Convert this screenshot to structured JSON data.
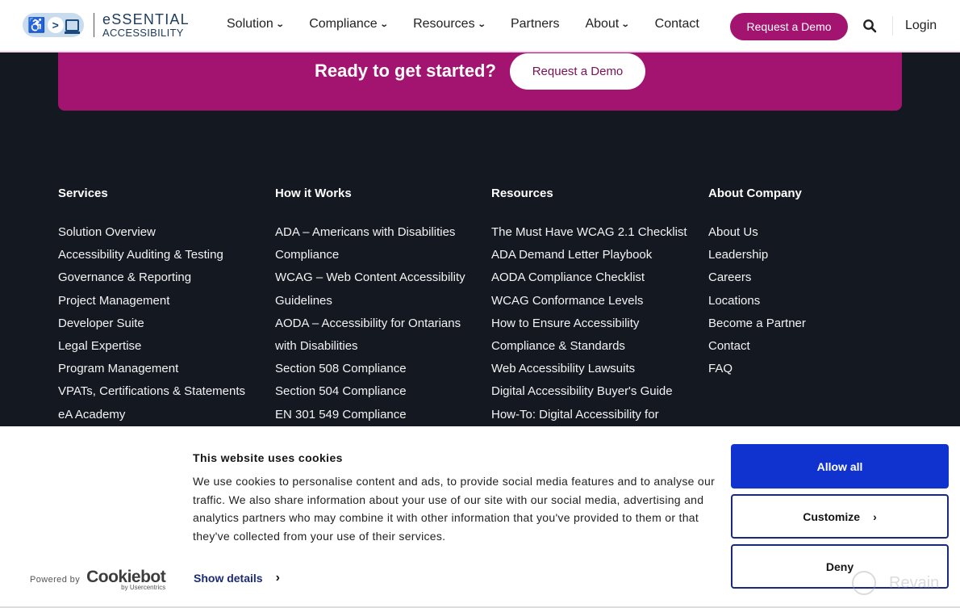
{
  "header": {
    "logo": {
      "line1": "eSSENTIAL",
      "line2": "ACCESSIBILITY",
      "icon_wheelchair": "♿",
      "icon_arrow": ">"
    },
    "nav": [
      {
        "label": "Solution",
        "has_dropdown": true
      },
      {
        "label": "Compliance",
        "has_dropdown": true
      },
      {
        "label": "Resources",
        "has_dropdown": true
      },
      {
        "label": "Partners",
        "has_dropdown": false
      },
      {
        "label": "About",
        "has_dropdown": true
      },
      {
        "label": "Contact",
        "has_dropdown": false
      }
    ],
    "chevron": "❯",
    "demo_button": "Request a Demo",
    "login": "Login"
  },
  "cta": {
    "title": "Ready to get started?",
    "button": "Request a Demo"
  },
  "footer": {
    "columns": [
      {
        "heading": "Services",
        "items": [
          "Solution Overview",
          "Accessibility Auditing & Testing",
          "Governance & Reporting",
          "Project Management",
          "Developer Suite",
          "Legal Expertise",
          "Program Management",
          "VPATs, Certifications & Statements",
          "eA Academy"
        ]
      },
      {
        "heading": "How it Works",
        "items": [
          "ADA – Americans with Disabilities",
          "Compliance",
          "WCAG – Web Content Accessibility",
          "Guidelines",
          "AODA – Accessibility for Ontarians",
          "with Disabilities",
          "Section 508 Compliance",
          "Section 504 Compliance",
          "EN 301 549 Compliance"
        ]
      },
      {
        "heading": "Resources",
        "items": [
          "The Must Have WCAG 2.1 Checklist",
          "ADA Demand Letter Playbook",
          "AODA Compliance Checklist",
          "WCAG Conformance Levels",
          "How to Ensure Accessibility",
          "Compliance & Standards",
          "Web Accessibility Lawsuits",
          "Digital Accessibility Buyer's Guide",
          "How-To: Digital Accessibility for"
        ]
      },
      {
        "heading": "About Company",
        "items": [
          "About Us",
          "Leadership",
          "Careers",
          "Locations",
          "Become a Partner",
          "Contact",
          "FAQ"
        ]
      }
    ]
  },
  "cookie_banner": {
    "title": "This website uses cookies",
    "body": "We use cookies to personalise content and ads, to provide social media features and to analyse our traffic. We also share information about your use of our site with our social media, advertising and analytics partners who may combine it with other information that you've provided to them or that they've collected from your use of their services.",
    "powered_by": "Powered by",
    "brand": "Cookiebot",
    "brand_sub": "by Usercentrics",
    "show_details": "Show details",
    "allow_all": "Allow all",
    "customize": "Customize",
    "deny": "Deny",
    "arrow": "›",
    "colors": {
      "allow_bg": "#1032cf",
      "border": "#1a2a7a"
    }
  },
  "watermark": {
    "text": "Revain"
  },
  "colors": {
    "brand": "#a31470",
    "footer_bg": "#131821"
  }
}
